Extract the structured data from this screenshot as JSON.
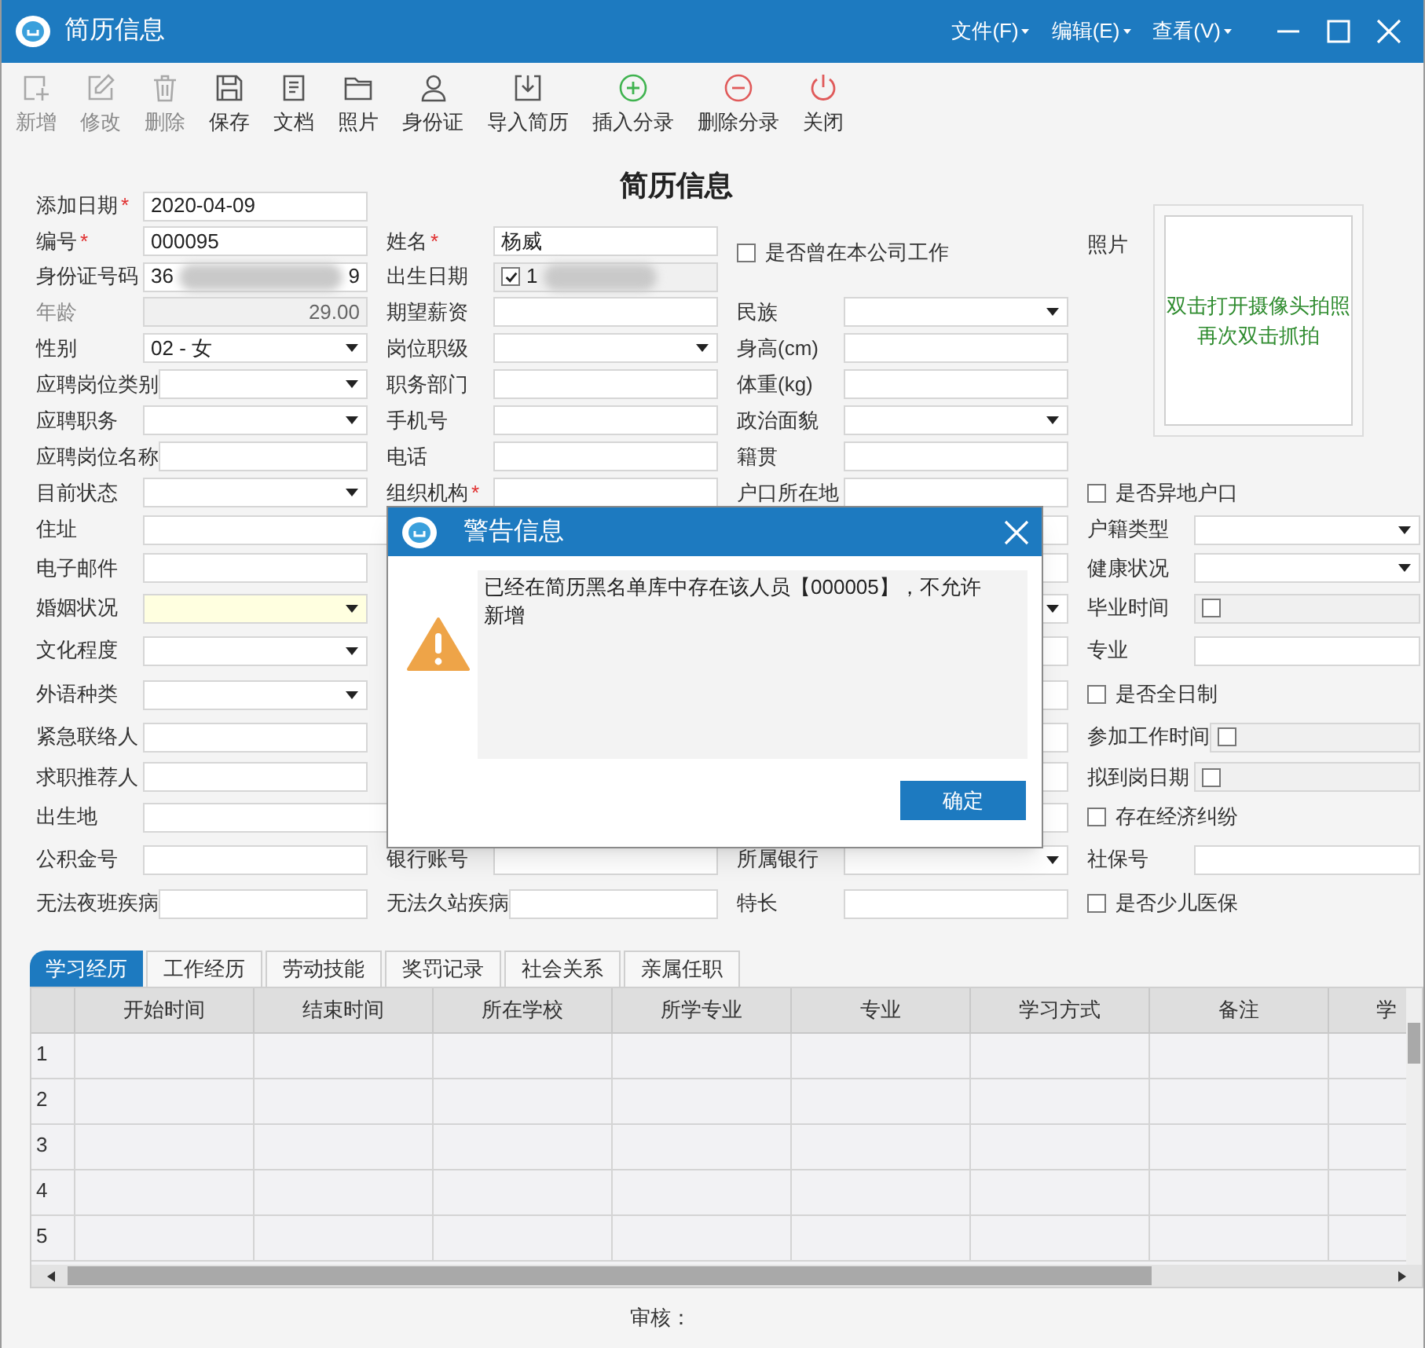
{
  "window": {
    "title": "简历信息",
    "menus": [
      {
        "label": "文件(F)"
      },
      {
        "label": "编辑(E)"
      },
      {
        "label": "查看(V)"
      }
    ]
  },
  "toolbar": [
    {
      "label": "新增",
      "kind": "add",
      "disabled": true
    },
    {
      "label": "修改",
      "kind": "edit",
      "disabled": true
    },
    {
      "label": "删除",
      "kind": "delete",
      "disabled": true
    },
    {
      "label": "保存",
      "kind": "save",
      "disabled": false
    },
    {
      "label": "文档",
      "kind": "document",
      "disabled": false
    },
    {
      "label": "照片",
      "kind": "folder",
      "disabled": false
    },
    {
      "label": "身份证",
      "kind": "person",
      "disabled": false
    },
    {
      "label": "导入简历",
      "kind": "import",
      "disabled": false
    },
    {
      "label": "插入分录",
      "kind": "insert",
      "disabled": false
    },
    {
      "label": "删除分录",
      "kind": "remove",
      "disabled": false
    },
    {
      "label": "关闭",
      "kind": "close",
      "disabled": false
    }
  ],
  "form": {
    "title": "简历信息",
    "photo": {
      "label": "照片",
      "hint_lines": [
        "双击打开摄像头拍照",
        "再次双击抓拍"
      ]
    },
    "rows": [
      {
        "col1": {
          "label": "添加日期",
          "required_mark": "*",
          "kind": "text",
          "value": "2020-04-09"
        }
      },
      {
        "col1": {
          "label": "编号",
          "required_mark": "*",
          "kind": "text",
          "value": "000095"
        },
        "col2": {
          "label": "姓名",
          "required_mark": "*",
          "kind": "text",
          "value": "杨威"
        },
        "col3": {
          "label": "是否曾在本公司工作",
          "kind": "check",
          "checked": false
        }
      },
      {
        "col1": {
          "label": "身份证号码",
          "kind": "text",
          "value": "36",
          "value_end": "9",
          "redacted": true
        },
        "col2": {
          "label": "出生日期",
          "kind": "date",
          "checked": true,
          "value": "1",
          "redacted": true
        }
      },
      {
        "col1": {
          "label": "年龄",
          "kind": "number",
          "disabled": true,
          "value": "29.00"
        },
        "col2": {
          "label": "期望薪资",
          "kind": "text"
        },
        "col3": {
          "label": "民族",
          "kind": "combo"
        }
      },
      {
        "col1": {
          "label": "性别",
          "kind": "combo",
          "value": "02 - 女"
        },
        "col2": {
          "label": "岗位职级",
          "kind": "combo"
        },
        "col3": {
          "label": "身高(cm)",
          "kind": "text"
        }
      },
      {
        "col1": {
          "label": "应聘岗位类别",
          "kind": "combo"
        },
        "col2": {
          "label": "职务部门",
          "kind": "text"
        },
        "col3": {
          "label": "体重(kg)",
          "kind": "text"
        }
      },
      {
        "col1": {
          "label": "应聘职务",
          "kind": "combo"
        },
        "col2": {
          "label": "手机号",
          "kind": "text"
        },
        "col3": {
          "label": "政治面貌",
          "kind": "combo"
        }
      },
      {
        "col1": {
          "label": "应聘岗位名称",
          "kind": "text"
        },
        "col2": {
          "label": "电话",
          "kind": "text"
        },
        "col3": {
          "label": "籍贯",
          "kind": "text"
        }
      },
      {
        "col1": {
          "label": "目前状态",
          "kind": "combo"
        },
        "col2": {
          "label": "组织机构",
          "required_mark": "*",
          "kind": "text"
        },
        "col3": {
          "label": "户口所在地",
          "kind": "text"
        },
        "col4": {
          "label": "是否异地户口",
          "kind": "check",
          "checked": false
        }
      },
      {
        "col1": {
          "label": "住址",
          "kind": "text",
          "wide": true
        },
        "col3": {
          "kind": "text"
        },
        "col4": {
          "label": "户籍类型",
          "kind": "combo"
        }
      },
      {
        "col1": {
          "label": "电子邮件",
          "kind": "text"
        },
        "col3": {
          "kind": "text"
        },
        "col4": {
          "label": "健康状况",
          "kind": "combo"
        }
      },
      {
        "col1": {
          "label": "婚姻状况",
          "kind": "combo",
          "highlighted": true
        },
        "col3": {
          "kind": "combo"
        },
        "col4": {
          "label": "毕业时间",
          "kind": "date",
          "checked": false
        }
      },
      {
        "col1": {
          "label": "文化程度",
          "kind": "combo"
        },
        "col3": {
          "kind": "text"
        },
        "col4": {
          "label": "专业",
          "kind": "text"
        }
      },
      {
        "col1": {
          "label": "外语种类",
          "kind": "combo"
        },
        "col3": {
          "kind": "text"
        },
        "col4": {
          "label": "是否全日制",
          "kind": "check",
          "checked": false
        }
      },
      {
        "col1": {
          "label": "紧急联络人",
          "kind": "text"
        },
        "col3": {
          "kind": "text"
        },
        "col4": {
          "label": "参加工作时间",
          "kind": "date",
          "checked": false
        }
      },
      {
        "col1": {
          "label": "求职推荐人",
          "kind": "text"
        },
        "col3": {
          "kind": "text"
        },
        "col4": {
          "label": "拟到岗日期",
          "kind": "date",
          "checked": false
        }
      },
      {
        "col1": {
          "label": "出生地",
          "kind": "text",
          "wide": true
        },
        "col3": {
          "kind": "text"
        },
        "col4": {
          "label": "存在经济纠纷",
          "kind": "check",
          "checked": false
        }
      },
      {
        "col1": {
          "label": "公积金号",
          "kind": "text"
        },
        "col2": {
          "label": "银行账号",
          "kind": "text"
        },
        "col3": {
          "label": "所属银行",
          "kind": "combo"
        },
        "col4": {
          "label": "社保号",
          "kind": "text"
        }
      },
      {
        "col1": {
          "label": "无法夜班疾病",
          "kind": "text"
        },
        "col2": {
          "label": "无法久站疾病",
          "kind": "text"
        },
        "col3": {
          "label": "特长",
          "kind": "text"
        },
        "col4": {
          "label": "是否少儿医保",
          "kind": "check",
          "checked": false
        }
      }
    ]
  },
  "tabs": [
    {
      "label": "学习经历",
      "selected": true
    },
    {
      "label": "工作经历",
      "selected": false
    },
    {
      "label": "劳动技能",
      "selected": false
    },
    {
      "label": "奖罚记录",
      "selected": false
    },
    {
      "label": "社会关系",
      "selected": false
    },
    {
      "label": "亲属任职",
      "selected": false
    }
  ],
  "table": {
    "columns": [
      "开始时间",
      "结束时间",
      "所在学校",
      "所学专业",
      "专业",
      "学习方式",
      "备注",
      "学"
    ],
    "rows": [
      {
        "number": "1"
      },
      {
        "number": "2"
      },
      {
        "number": "3"
      },
      {
        "number": "4"
      },
      {
        "number": "5"
      }
    ]
  },
  "footer": {
    "label": "审核："
  },
  "dialog": {
    "title": "警告信息",
    "message": "已经在简历黑名单库中存在该人员【000005】，不允许新增",
    "buttons": [
      "确定"
    ]
  }
}
